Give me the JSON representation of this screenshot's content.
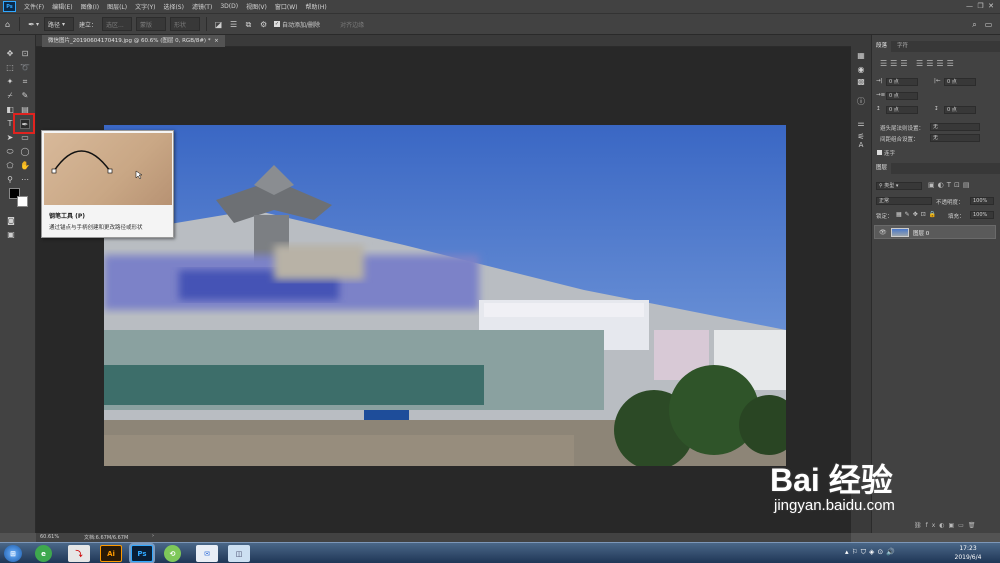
{
  "app": {
    "logo": "Ps"
  },
  "menu": [
    "文件(F)",
    "编辑(E)",
    "图像(I)",
    "图层(L)",
    "文字(Y)",
    "选择(S)",
    "滤镜(T)",
    "3D(D)",
    "视图(V)",
    "窗口(W)",
    "帮助(H)"
  ],
  "options": {
    "mode": "路径",
    "make_label": "建立：",
    "selection_btn": "选区...",
    "mask_btn": "蒙版",
    "shape_btn": "形状",
    "auto_add_delete": "自动添加/删除",
    "align_edges": "对齐边缘"
  },
  "document": {
    "tab_title": "微信图片_20190604170419.jpg @ 60.6% (图层 0, RGB/8#) *",
    "zoom": "60.61%",
    "doc_size": "文档:6.67M/6.67M"
  },
  "tooltip": {
    "title": "钢笔工具 (P)",
    "desc": "通过锚点与手柄创建和更改路径或形状"
  },
  "paragraph_panel": {
    "tabs": [
      "段落",
      "字符"
    ],
    "indent_left": "0 点",
    "indent_right": "0 点",
    "indent_first": "0 点",
    "space_before": "0 点",
    "space_after": "0 点",
    "avoid_label": "避头尾法则设置：",
    "avoid_value": "无",
    "spacing_label": "间距组合设置：",
    "spacing_value": "无",
    "hyphenate": "连字"
  },
  "layers_panel": {
    "tab": "图层",
    "filter_kind": "类型",
    "blend_mode": "正常",
    "opacity_label": "不透明度：",
    "opacity": "100%",
    "lock_label": "锁定：",
    "fill_label": "填充：",
    "fill": "100%",
    "layers": [
      {
        "name": "图层 0"
      }
    ]
  },
  "taskbar": {
    "time": "17:23",
    "date": "2019/6/4",
    "apps": [
      "Ai",
      "Ps"
    ]
  },
  "watermark": {
    "line1": "Bai 经验",
    "line2": "jingyan.baidu.com"
  }
}
